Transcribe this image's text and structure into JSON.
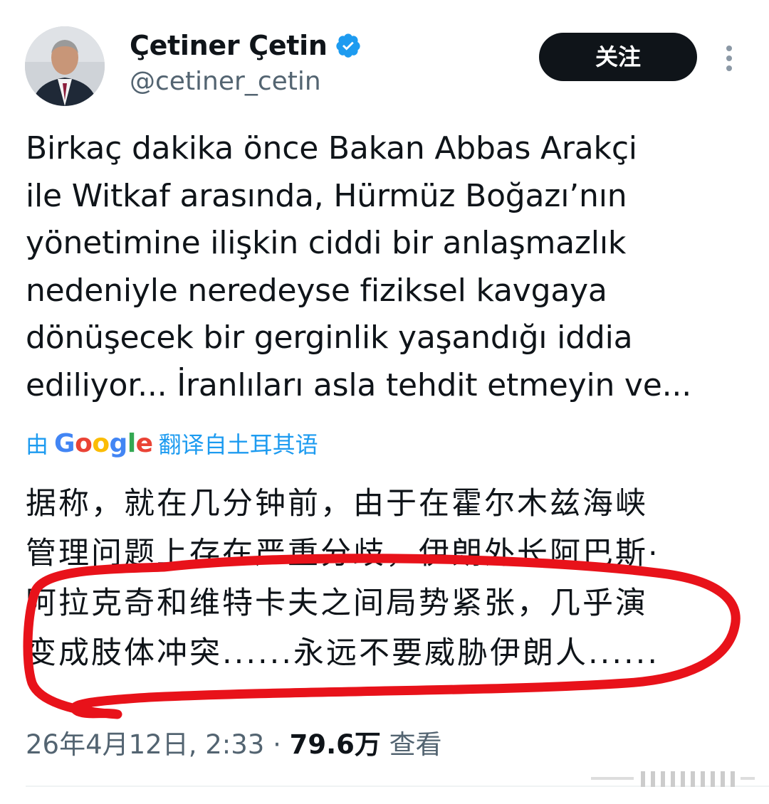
{
  "author": {
    "name": "Çetiner Çetin",
    "handle": "@cetiner_cetin",
    "verified": true,
    "follow_label": "关注"
  },
  "tweet": {
    "text": "Birkaç dakika önce Bakan Abbas Arakçi\nile Witkaf arasında, Hürmüz Boğazı’nın\nyönetimine ilişkin ciddi bir anlaşmazlık\nnedeniyle neredeyse fiziksel kavgaya\ndönüşecek bir gerginlik yaşandığı iddia\nediliyor... İranlıları asla tehdit etmeyin ve...",
    "translation_prefix": "由",
    "translation_brand": "Google",
    "translation_suffix": "翻译自土耳其语",
    "translated_text": "据称，就在几分钟前，由于在霍尔木兹海峡\n管理问题上存在严重分歧，伊朗外长阿巴斯·\n阿拉克奇和维特卡夫之间局势紧张，几乎演\n变成肢体冲突......永远不要威胁伊朗人......",
    "timestamp": "26年4月12日, 2:33",
    "separator": "·",
    "view_count": "79.6万",
    "view_label": "查看"
  },
  "colors": {
    "text": "#0f1419",
    "secondary": "#536471",
    "link": "#1d9bf0",
    "verified_badge": "#1d9bf0",
    "follow_bg": "#0f1419",
    "annotation": "#e8121a"
  },
  "icons": {
    "verified": "verified-badge-icon",
    "more": "more-vertical-icon",
    "avatar": "profile-photo"
  }
}
